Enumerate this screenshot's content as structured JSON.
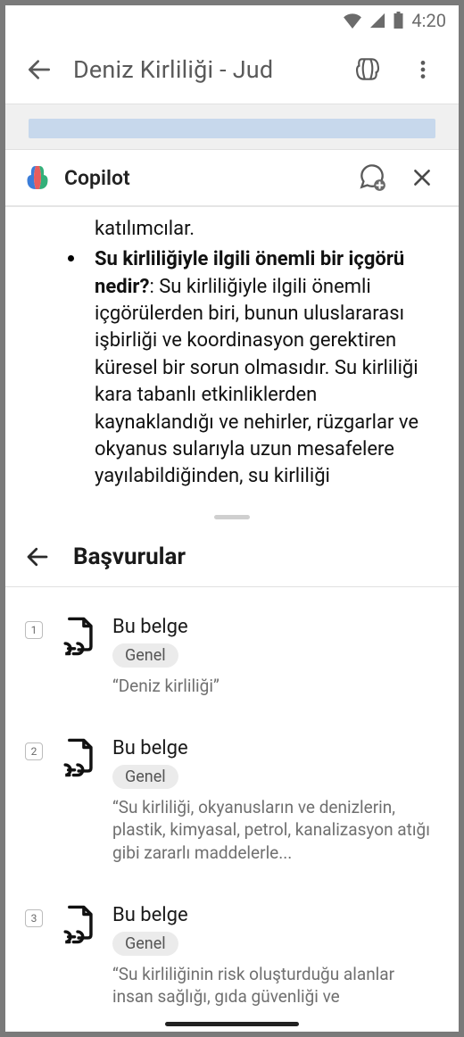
{
  "statusbar": {
    "time": "4:20"
  },
  "header": {
    "title": "Deniz Kirliliği - Jud"
  },
  "copilot": {
    "label": "Copilot",
    "content": {
      "line1": "katılımcılar.",
      "bullet_bold": "Su kirliliğiyle ilgili önemli bir içgörü nedir?",
      "bullet_rest": ": Su kirliliğiyle ilgili önemli içgörülerden biri, bunun uluslararası işbirliği ve koordinasyon gerektiren küresel bir sorun olmasıdır. Su kirliliği kara tabanlı etkinliklerden kaynaklandığı ve nehirler, rüzgarlar ve okyanus sularıyla uzun mesafelere yayılabildiğinden, su kirliliği"
    }
  },
  "references": {
    "title": "Başvurular",
    "items": [
      {
        "num": "1",
        "title": "Bu belge",
        "tag": "Genel",
        "snippet": "“Deniz kirliliği”"
      },
      {
        "num": "2",
        "title": "Bu belge",
        "tag": "Genel",
        "snippet": "“Su kirliliği, okyanusların ve denizlerin, plastik, kimyasal, petrol, kanalizasyon atığı gibi zararlı maddelerle..."
      },
      {
        "num": "3",
        "title": "Bu belge",
        "tag": "Genel",
        "snippet": "“Su kirliliğinin risk oluşturduğu alanlar insan sağlığı, gıda güvenliği ve"
      }
    ]
  }
}
